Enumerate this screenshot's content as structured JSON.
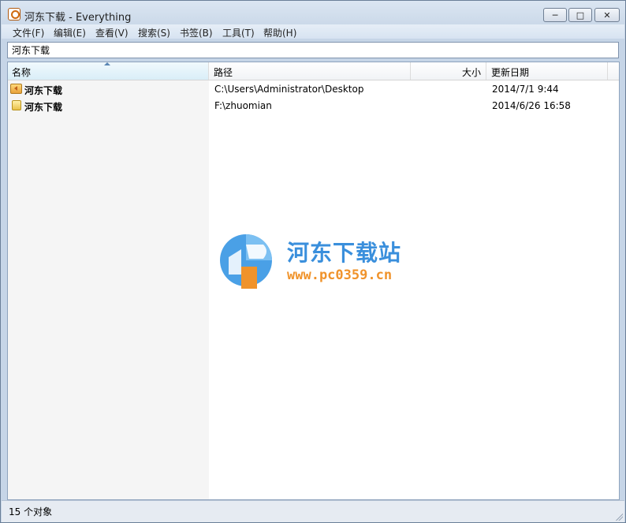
{
  "window": {
    "title": "河东下载 - Everything",
    "icon": "everything-app-icon",
    "controls": {
      "minimize_icon": "minimize-icon",
      "maximize_icon": "maximize-icon",
      "close_icon": "close-icon"
    }
  },
  "menu": {
    "items": [
      {
        "label": "文件(F)"
      },
      {
        "label": "编辑(E)"
      },
      {
        "label": "查看(V)"
      },
      {
        "label": "搜索(S)"
      },
      {
        "label": "书签(B)"
      },
      {
        "label": "工具(T)"
      },
      {
        "label": "帮助(H)"
      }
    ]
  },
  "search": {
    "value": "河东下载"
  },
  "columns": {
    "name": "名称",
    "path": "路径",
    "size": "大小",
    "modified": "更新日期",
    "sorted_by": "name",
    "sort_direction": "ascending"
  },
  "rows": [
    {
      "name": "河东下载",
      "path": "C:\\Users\\Administrator\\Desktop",
      "size": "",
      "modified": "2014/7/1 9:44",
      "icon": "desktop-folder-icon"
    },
    {
      "name": "河东下载",
      "path": "F:\\zhuomian",
      "size": "",
      "modified": "2014/6/26 16:58",
      "icon": "folder-icon"
    }
  ],
  "watermark": {
    "title": "河东下载站",
    "url": "www.pc0359.cn"
  },
  "status": {
    "text": "15 个对象"
  },
  "colors": {
    "accent": "#3a8fdc",
    "watermark_url": "#f0932b",
    "header_selected": "#d9eef8"
  }
}
